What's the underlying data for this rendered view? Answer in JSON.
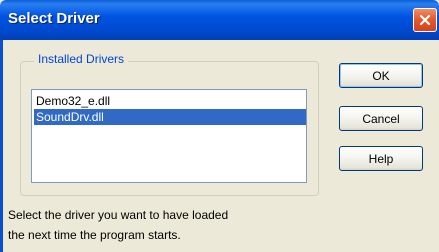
{
  "window": {
    "title": "Select Driver",
    "close_icon": "close-icon"
  },
  "colors": {
    "title_bar": "#0054e3",
    "dialog_background": "#ece9d8",
    "group_label": "#0046d5",
    "selection": "#316ac5",
    "close_button": "#e35b2d"
  },
  "drivers": {
    "group_label": "Installed Drivers",
    "items": [
      {
        "label": "Demo32_e.dll",
        "selected": false
      },
      {
        "label": "SoundDrv.dll",
        "selected": true
      }
    ]
  },
  "buttons": {
    "ok_label": "OK",
    "cancel_label": "Cancel",
    "help_label": "Help"
  },
  "description": {
    "line1": "Select the driver you want to have loaded",
    "line2": "the next time the program starts."
  }
}
